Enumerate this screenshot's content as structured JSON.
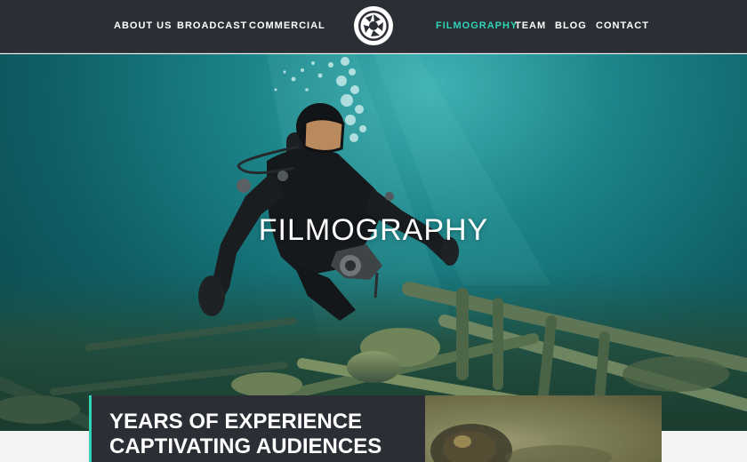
{
  "nav": {
    "left_items": [
      {
        "label": "ABOUT US"
      },
      {
        "label": "BROADCAST"
      },
      {
        "label": "COMMERCIAL"
      }
    ],
    "right_items": [
      {
        "label": "FILMOGRAPHY",
        "active": true
      },
      {
        "label": "TEAM"
      },
      {
        "label": "BLOG"
      },
      {
        "label": "CONTACT"
      }
    ],
    "logo_icon": "camera-aperture-logo-icon"
  },
  "hero": {
    "title": "FILMOGRAPHY",
    "image": "scuba-diver-over-shipwreck"
  },
  "section": {
    "heading_line1": "YEARS OF EXPERIENCE",
    "heading_line2": "CAPTIVATING AUDIENCES",
    "image": "underwater-fish-closeup"
  },
  "colors": {
    "nav_bg": "#2b2f35",
    "accent": "#2fd3b6",
    "text": "#ffffff",
    "page_bg": "#f2f3f3"
  }
}
